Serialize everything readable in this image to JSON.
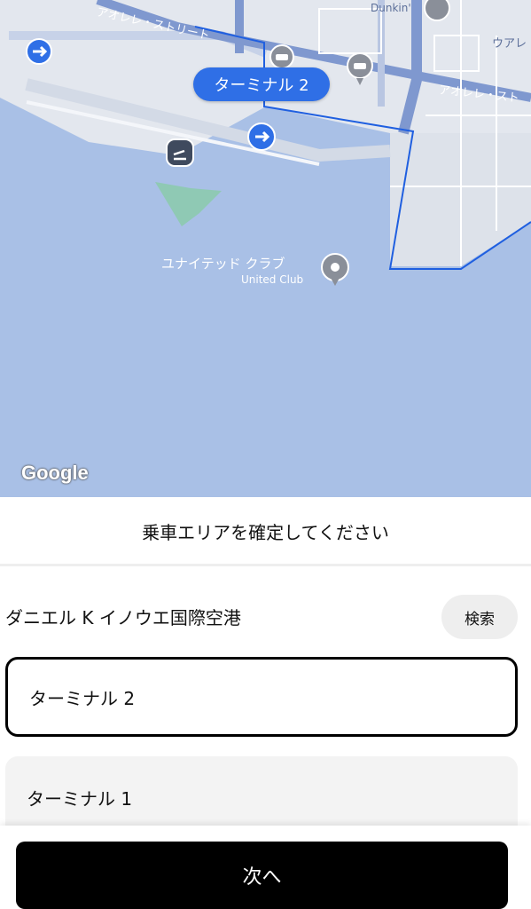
{
  "map": {
    "street_top_left": "アオレレ・ストリート",
    "street_right_top": "ウアレ",
    "street_right_mid": "アオレレ・スト",
    "poi_dunkin": "Dunkin'",
    "poi_united_ja": "ユナイテッド クラブ",
    "poi_united_en": "United Club",
    "selected_pin_label": "ターミナル 2",
    "google_logo": "Google"
  },
  "sheet": {
    "title": "乗車エリアを確定してください",
    "airport_name": "ダニエル K イノウエ国際空港",
    "search_label": "検索",
    "options": [
      {
        "label": "ターミナル 2",
        "selected": true
      },
      {
        "label": "ターミナル 1",
        "selected": false
      }
    ],
    "next_label": "次へ"
  },
  "colors": {
    "water": "#a9c0e6",
    "land": "#e3e7ee",
    "accent_blue": "#2f6fe6",
    "button_black": "#000000"
  }
}
